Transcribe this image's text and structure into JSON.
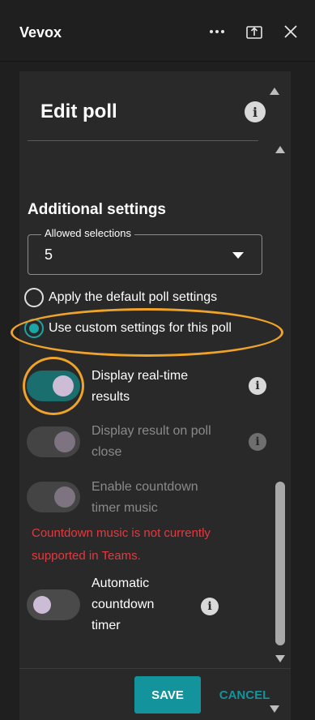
{
  "header": {
    "app_title": "Vevox",
    "more_icon": "more-horizontal-icon",
    "popout_icon": "popout-icon",
    "close_icon": "close-icon"
  },
  "edit": {
    "title": "Edit poll",
    "info_icon": "info-icon"
  },
  "additional_settings": {
    "title": "Additional settings",
    "allowed_selections": {
      "label": "Allowed selections",
      "value": "5"
    },
    "radio_options": [
      {
        "label": "Apply the default poll settings",
        "checked": false
      },
      {
        "label": "Use custom settings for this poll",
        "checked": true
      }
    ],
    "toggles": [
      {
        "label_line1": "Display real-time",
        "label_line2": "results",
        "state": "on",
        "enabled": true
      },
      {
        "label_line1": "Display result on poll",
        "label_line2": "close",
        "state": "on",
        "enabled": false
      },
      {
        "label_line1": "Enable countdown",
        "label_line2": "timer music",
        "state": "on",
        "enabled": false
      },
      {
        "label_line1": "Automatic",
        "label_line2": "countdown",
        "label_line3": "timer",
        "state": "off",
        "enabled": true
      }
    ],
    "warning_line1": "Countdown music is not currently",
    "warning_line2": "supported in Teams."
  },
  "footer": {
    "save_label": "SAVE",
    "cancel_label": "CANCEL"
  },
  "colors": {
    "accent": "#13939b",
    "warning": "#e5393f",
    "annotation": "#f0a32a",
    "background": "#1f1f1f",
    "panel": "#292929"
  }
}
